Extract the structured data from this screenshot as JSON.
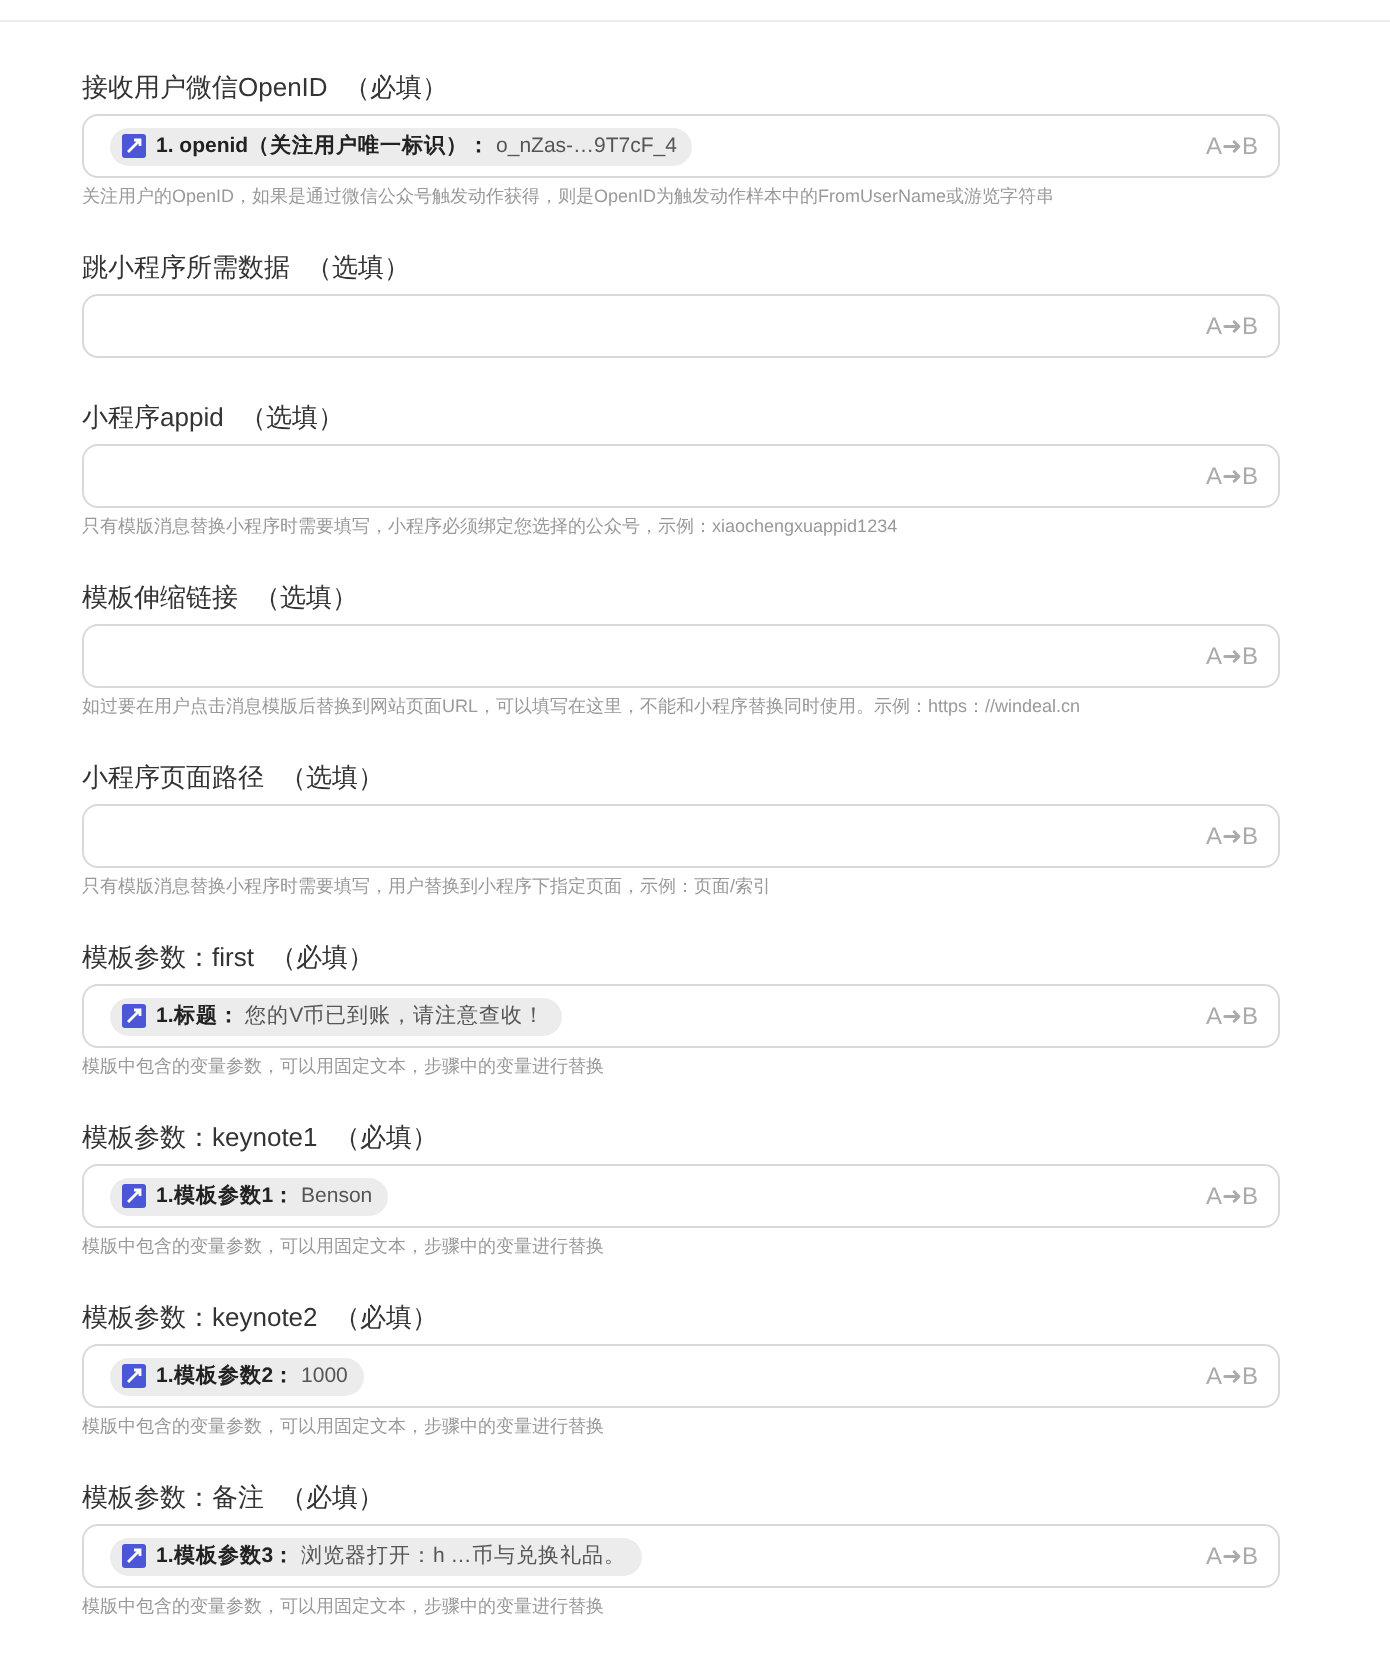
{
  "fields": [
    {
      "label": "接收用户微信OpenID",
      "requirement": "（必填）",
      "tag": "**1. openid（关注用户唯一标识）：** o_nZas-…9T7cF_4",
      "convert": "A➜B",
      "help": "关注用户的OpenID，如果是通过微信公众号触发动作获得，则是OpenID为触发动作样本中的FromUserName或游览字符串"
    },
    {
      "label": "跳小程序所需数据",
      "requirement": "（选填）",
      "convert": "A➜B"
    },
    {
      "label": "小程序appid",
      "requirement": "（选填）",
      "convert": "A➜B",
      "help": "只有模版消息替换小程序时需要填写，小程序必须绑定您选择的公众号，示例：xiaochengxuappid1234"
    },
    {
      "label": "模板伸缩链接",
      "requirement": "（选填）",
      "convert": "A➜B",
      "help": "如过要在用户点击消息模版后替换到网站页面URL，可以填写在这里，不能和小程序替换同时使用。示例：https：//windeal.cn"
    },
    {
      "label": "小程序页面路径",
      "requirement": "（选填）",
      "convert": "A➜B",
      "help": "只有模版消息替换小程序时需要填写，用户替换到小程序下指定页面，示例：页面/索引"
    },
    {
      "label": "模板参数：first",
      "requirement": "（必填）",
      "tag": "**1.标题：** 您的V币已到账，请注意查收！",
      "convert": "A➜B",
      "help": "模版中包含的变量参数，可以用固定文本，步骤中的变量进行替换"
    },
    {
      "label": "模板参数：keynote1",
      "requirement": "（必填）",
      "tag": "**1.模板参数1：** Benson",
      "convert": "A➜B",
      "help": "模版中包含的变量参数，可以用固定文本，步骤中的变量进行替换"
    },
    {
      "label": "模板参数：keynote2",
      "requirement": "（必填）",
      "tag": "**1.模板参数2：** 1000",
      "convert": "A➜B",
      "help": "模版中包含的变量参数，可以用固定文本，步骤中的变量进行替换"
    },
    {
      "label": "模板参数：备注",
      "requirement": "（必填）",
      "tag": "**1.模板参数3：** 浏览器打开：h …币与兑换礼品。",
      "convert": "A➜B",
      "help": "模版中包含的变量参数，可以用固定文本，步骤中的变量进行替换"
    }
  ]
}
